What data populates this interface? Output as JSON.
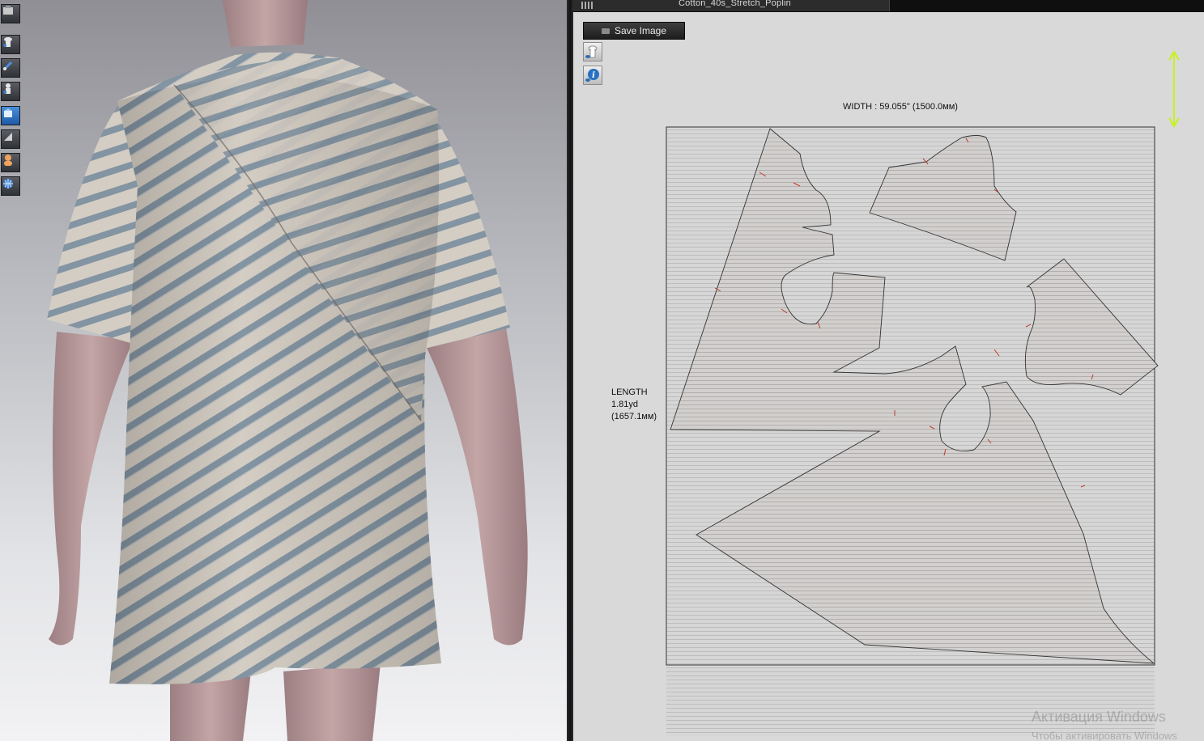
{
  "window": {
    "fabric_name": "Cotton_40s_Stretch_Poplin"
  },
  "toolbar_3d": {
    "icons": [
      "render-snapshot-icon",
      "show-garment-icon",
      "show-pins-icon",
      "show-avatar-icon",
      "texture-icon",
      "measure-icon",
      "avatar-skin-icon",
      "world-grid-icon"
    ]
  },
  "panel_2d": {
    "save_image_label": "Save Image",
    "icons": [
      "show-garment-icon",
      "info-icon"
    ],
    "width_label": "WIDTH : 59.055\" (1500.0мм)",
    "length_title": "LENGTH",
    "length_yd": "1.81yd",
    "length_mm": "(1657.1мм)"
  },
  "watermark": {
    "title": "Активация Windows",
    "subtitle": "Чтобы активировать Windows"
  },
  "colors": {
    "grain_arrow": "#c6f21a",
    "stripe": "#7e8f9c",
    "fabric_base": "#d3ccc2",
    "avatar_skin": "#b99a9c",
    "notch": "#c0392b"
  }
}
